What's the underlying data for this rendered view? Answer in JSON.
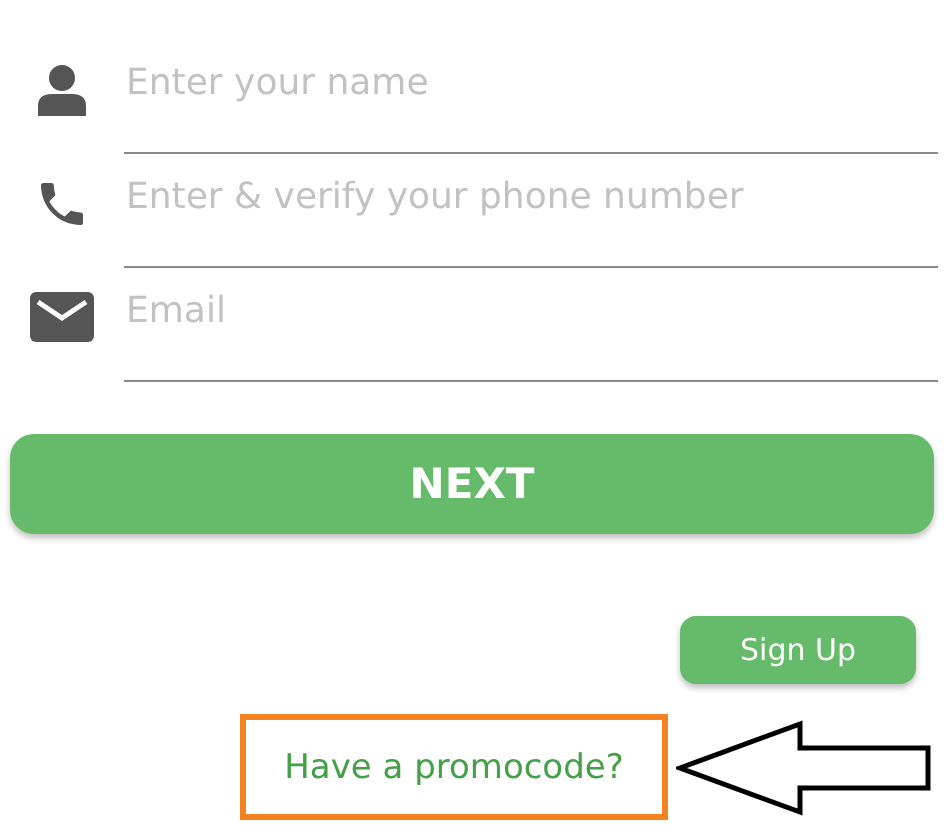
{
  "fields": [
    {
      "kind": "person",
      "placeholder": "Enter your name"
    },
    {
      "kind": "phone",
      "placeholder": "Enter & verify your phone number"
    },
    {
      "kind": "email",
      "placeholder": "Email"
    }
  ],
  "next_button": "NEXT",
  "signup_button": "Sign Up",
  "promo_link": "Have a promocode?"
}
